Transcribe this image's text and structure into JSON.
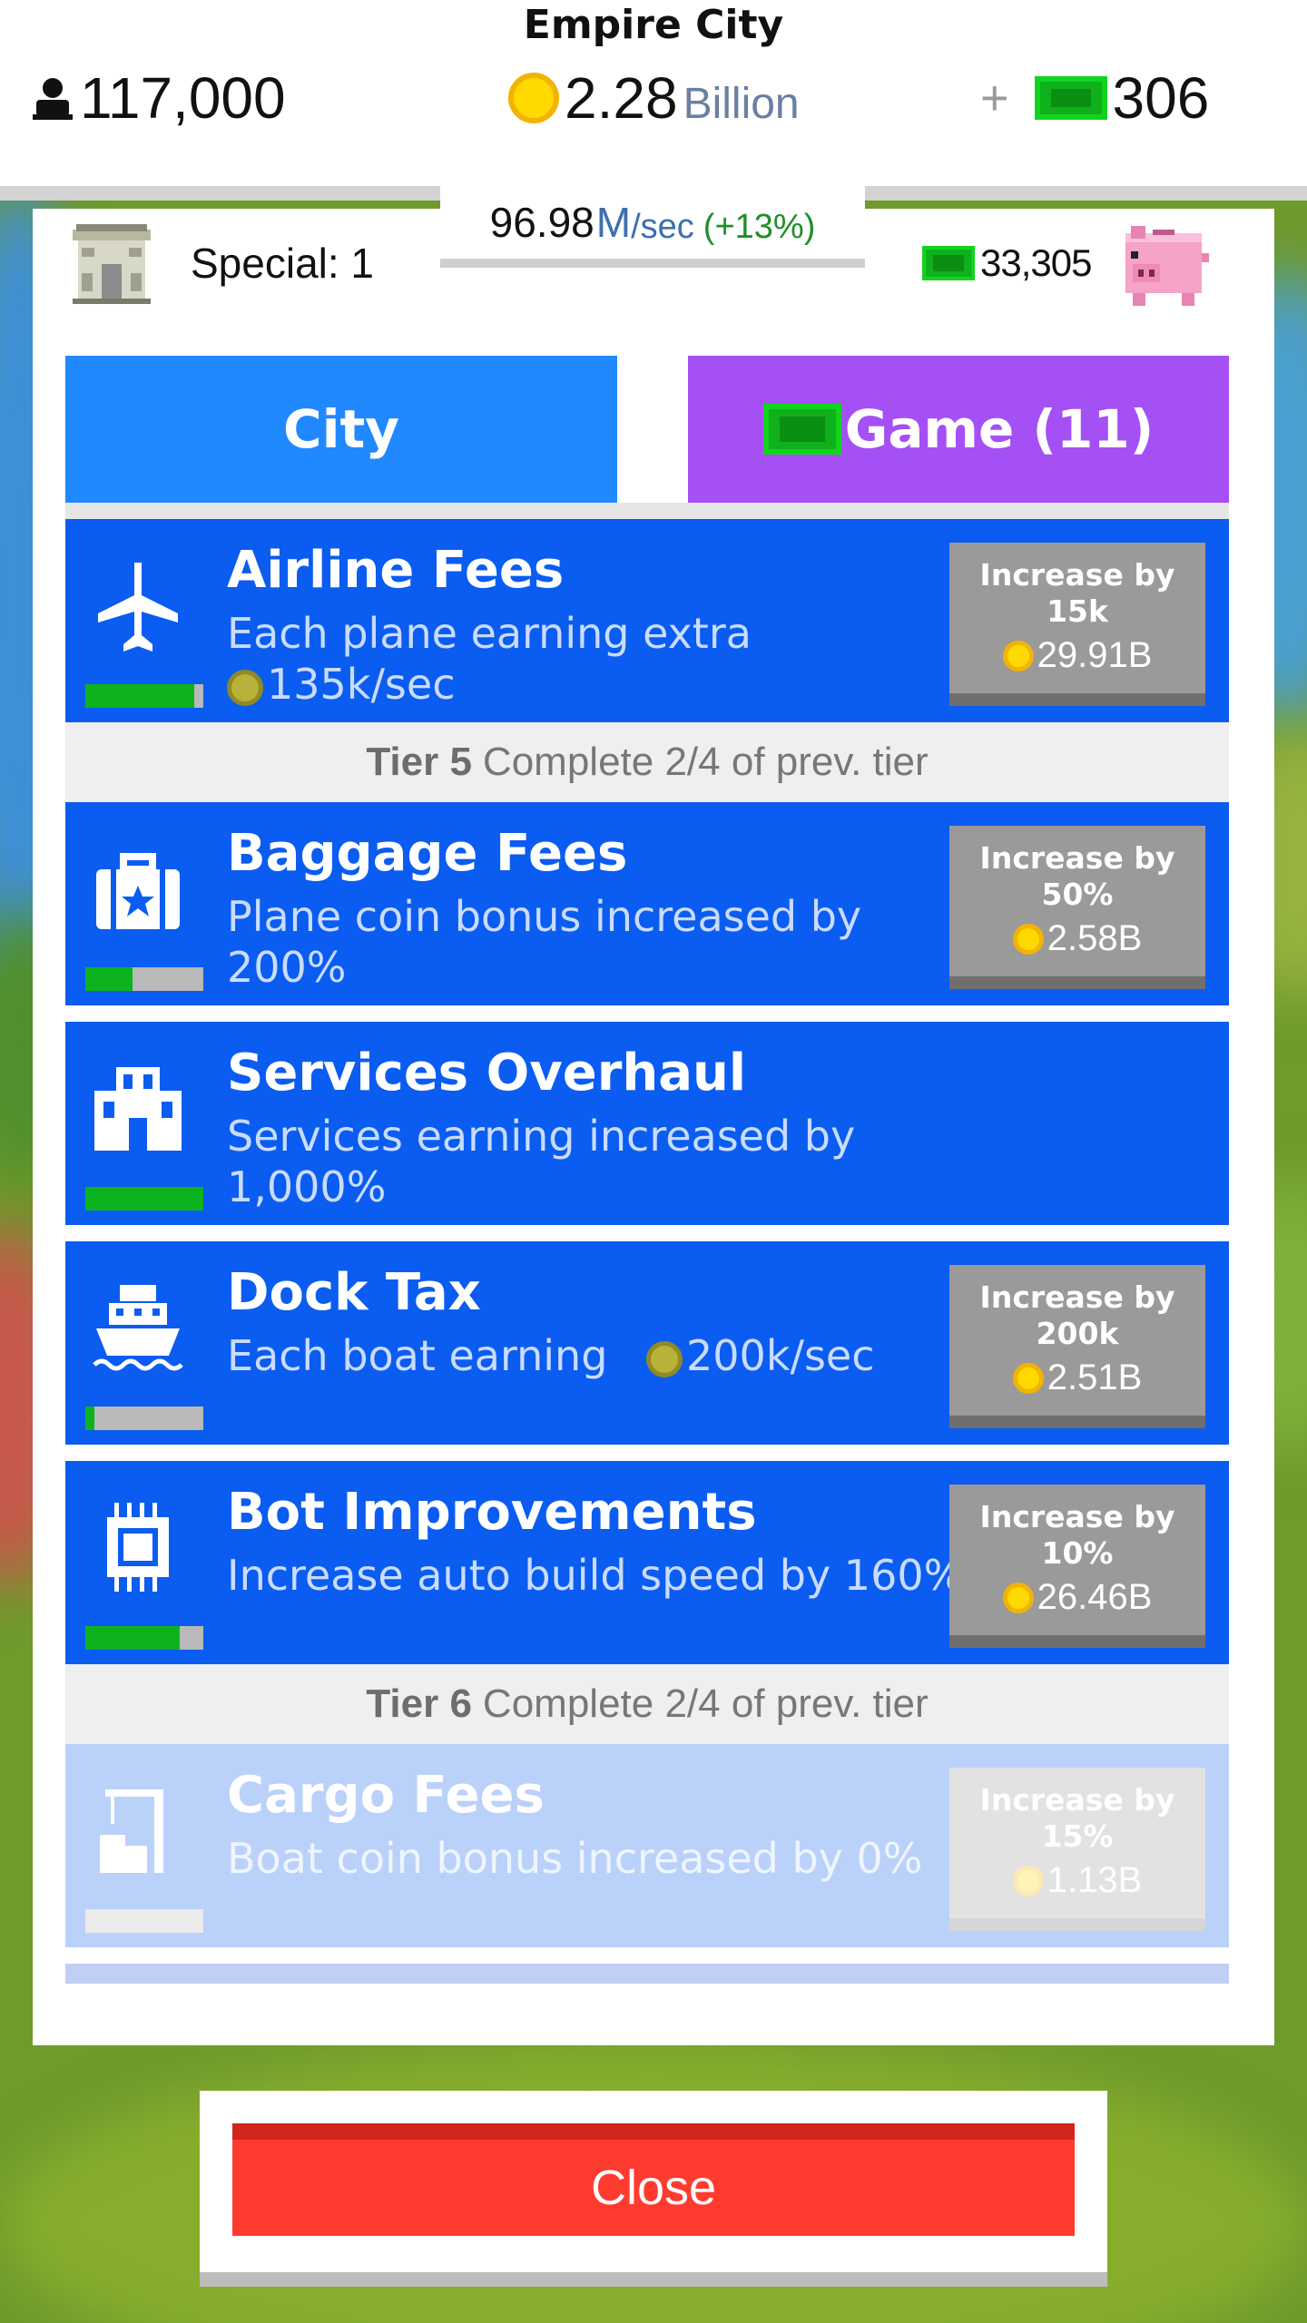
{
  "header": {
    "city_name": "Empire City",
    "population": "117,000",
    "coins": "2.28",
    "coins_unit": "Billion",
    "cash_plus": "+",
    "cash": "306"
  },
  "rate": {
    "value": "96.98",
    "unit": "M",
    "per": "/sec",
    "bonus": "(+13%)"
  },
  "special": {
    "label": "Special: 1"
  },
  "bank": {
    "value": "33,305"
  },
  "tabs": {
    "city": "City",
    "game": "Game (11)"
  },
  "upgrades": [
    {
      "title": "Airline Fees",
      "desc": "Each plane earning extra",
      "desc_value": "135k/sec",
      "progress": 0.92,
      "buy_label": "Increase by",
      "buy_amount": "15k",
      "buy_price": "29.91B",
      "icon": "airplane-icon"
    },
    {
      "title": "Baggage Fees",
      "desc": "Plane coin bonus increased by 200%",
      "progress": 0.4,
      "buy_label": "Increase by",
      "buy_amount": "50%",
      "buy_price": "2.58B",
      "icon": "suitcase-icon"
    },
    {
      "title": "Services Overhaul",
      "desc": "Services earning increased by 1,000%",
      "progress": 1.0,
      "icon": "building-icon"
    },
    {
      "title": "Dock Tax",
      "desc": "Each boat earning",
      "desc_value": "200k/sec",
      "progress": 0.08,
      "buy_label": "Increase by",
      "buy_amount": "200k",
      "buy_price": "2.51B",
      "icon": "ship-icon"
    },
    {
      "title": "Bot Improvements",
      "desc": "Increase auto build speed by 160%",
      "progress": 0.8,
      "buy_label": "Increase by",
      "buy_amount": "10%",
      "buy_price": "26.46B",
      "icon": "chip-icon"
    },
    {
      "title": "Cargo Fees",
      "desc": "Boat coin bonus increased by 0%",
      "progress": 0.0,
      "buy_label": "Increase by",
      "buy_amount": "15%",
      "buy_price": "1.13B",
      "icon": "crane-icon"
    }
  ],
  "tiers": [
    {
      "name": "Tier 5",
      "text": "Complete 2/4 of prev. tier"
    },
    {
      "name": "Tier 6",
      "text": "Complete 2/4 of prev. tier"
    }
  ],
  "close_label": "Close",
  "colors": {
    "accent_blue": "#0b5cf0",
    "tab_city": "#2189ff",
    "tab_game": "#a450f5",
    "progress_green": "#0cb31e",
    "close_red": "#ff3b30"
  }
}
